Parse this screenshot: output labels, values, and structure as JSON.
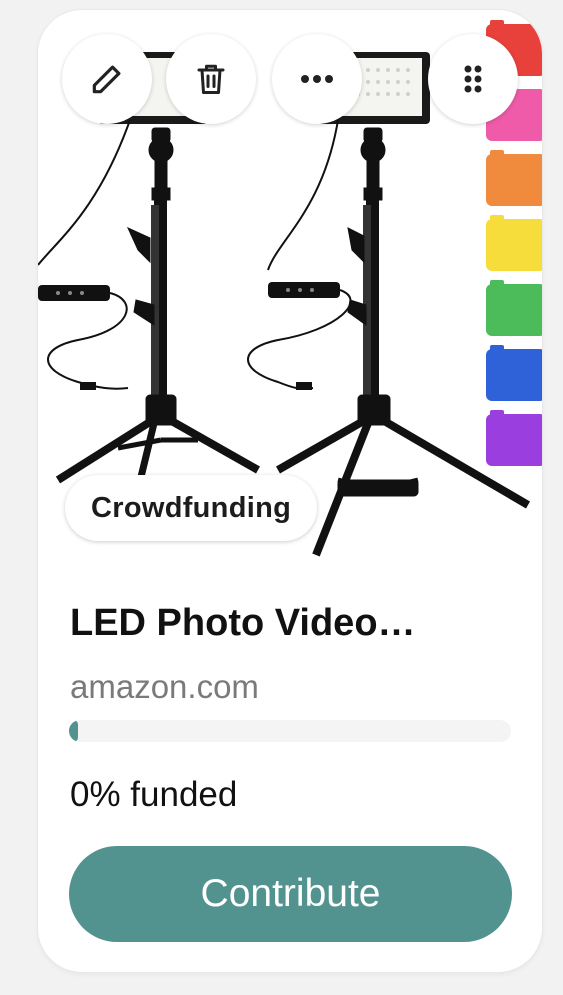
{
  "card": {
    "badge_label": "Crowdfunding",
    "title": "LED Photo Video…",
    "domain": "amazon.com",
    "progress_fraction": 0.02,
    "funded_label": "0% funded",
    "contribute_label": "Contribute"
  },
  "actions": [
    "edit-icon",
    "delete-icon",
    "more-icon",
    "drag-handle-icon"
  ],
  "colors": {
    "accent": "#52938f",
    "filters": [
      "#e8413b",
      "#ef5ba8",
      "#f08a3c",
      "#f7dd3c",
      "#4cbb5a",
      "#2f62d9",
      "#9a3ee0"
    ]
  }
}
